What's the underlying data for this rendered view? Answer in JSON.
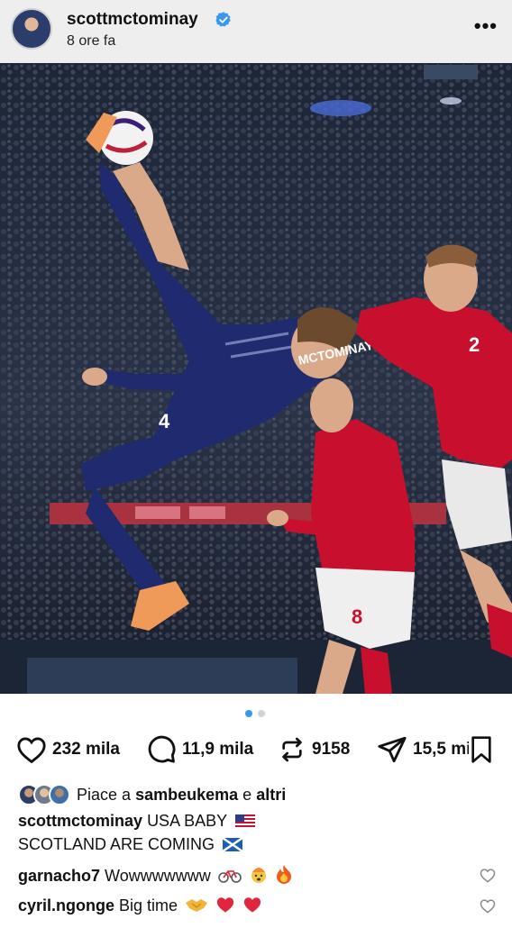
{
  "post": {
    "username": "scottmctominay",
    "time_ago": "8 ore fa",
    "more_icon": "more-horizontal-icon"
  },
  "photo": {
    "jersey_name": "MCTOMINAY",
    "left_shorts_number": "4",
    "right_player_number": "2",
    "middle_player_number": "8"
  },
  "carousel": {
    "total": 2,
    "active": 1
  },
  "actions": {
    "likes": "232 mila",
    "comments": "11,9 mila",
    "reposts": "9158",
    "shares": "15,5 mila"
  },
  "liked_by": {
    "prefix": "Piace a",
    "user": "sambeukema",
    "connector": "e",
    "others": "altri"
  },
  "caption": {
    "username": "scottmctominay",
    "line1": "USA BABY",
    "line2": "SCOTLAND ARE COMING"
  },
  "comments": [
    {
      "username": "garnacho7",
      "text": "Wowwwwwww"
    },
    {
      "username": "cyril.ngonge",
      "text": "Big time"
    }
  ],
  "colors": {
    "accent_blue": "#3897f0",
    "scotland_navy": "#1f2b6e",
    "denmark_red": "#c8102e"
  }
}
